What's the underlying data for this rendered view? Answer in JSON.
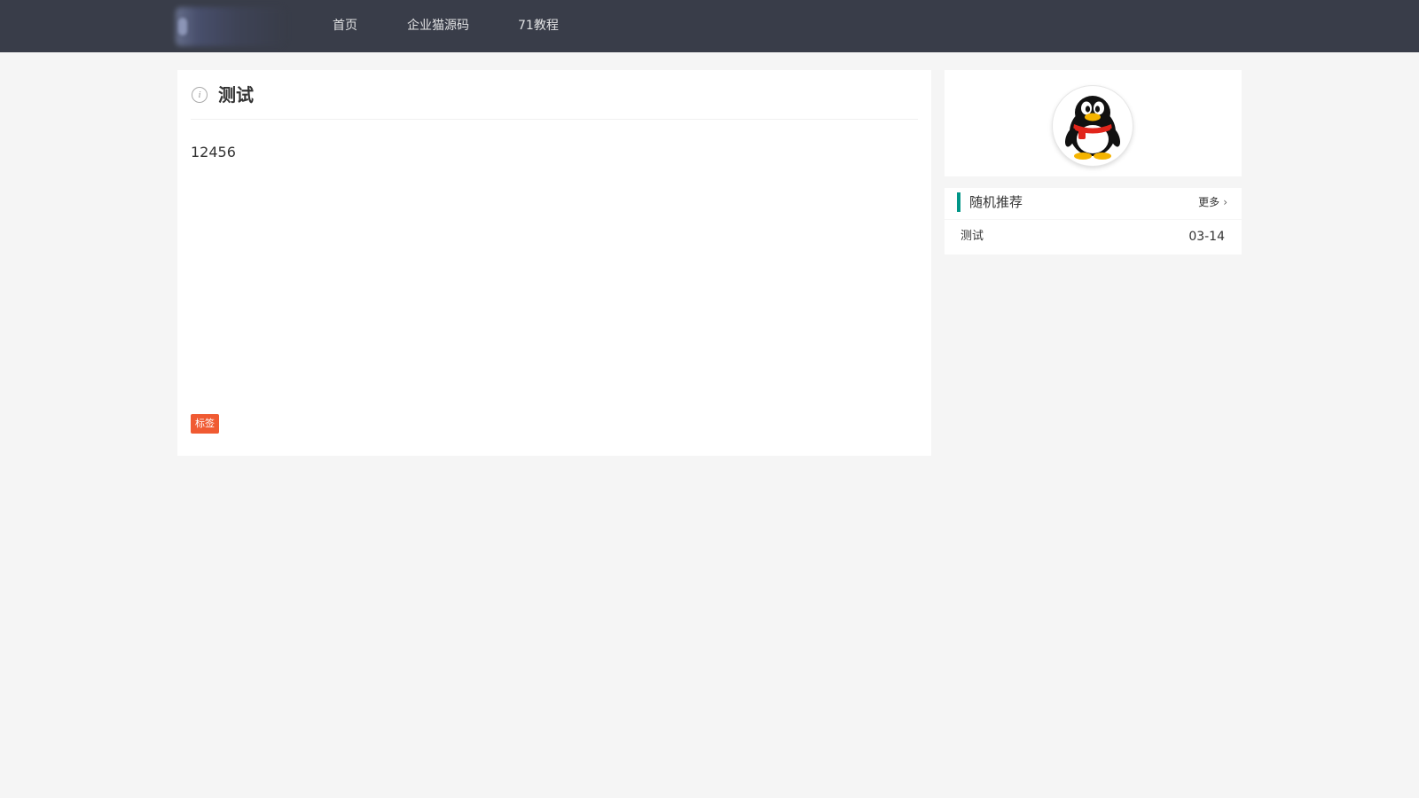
{
  "header": {
    "nav": [
      {
        "label": "首页"
      },
      {
        "label": "企业猫源码"
      },
      {
        "label": "71教程"
      }
    ]
  },
  "article": {
    "info_icon": "info-circle-icon",
    "title": "测试",
    "content": "12456",
    "tag": "标签"
  },
  "profile": {
    "avatar_icon": "qq-penguin-avatar"
  },
  "recommend": {
    "title": "随机推荐",
    "more_label": "更多",
    "more_icon": "chevron-right-icon",
    "items": [
      {
        "title": "测试",
        "date": "03-14"
      }
    ]
  },
  "colors": {
    "topbar": "#393d49",
    "page_background": "#f5f5f5",
    "accent": "#009688",
    "tag": "#f05a32"
  }
}
